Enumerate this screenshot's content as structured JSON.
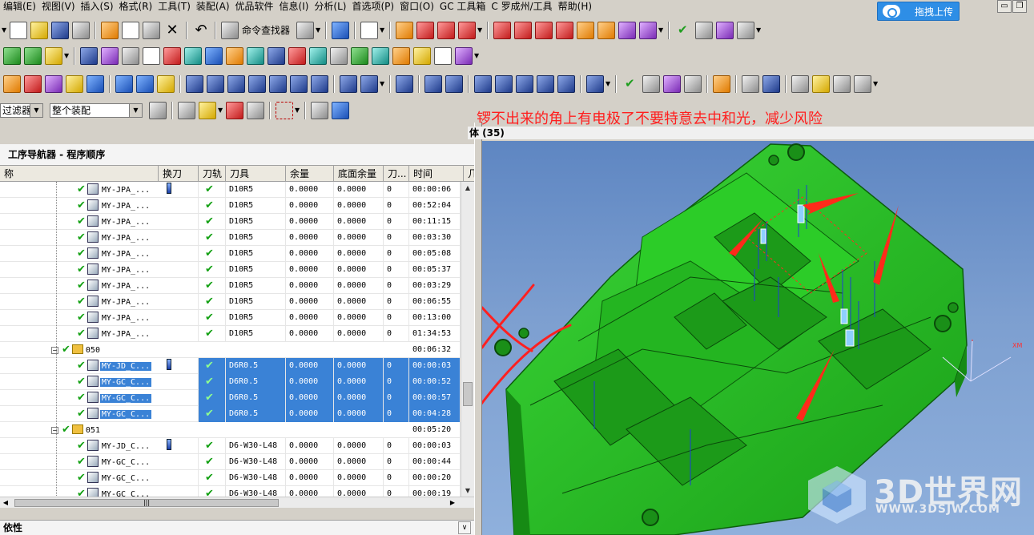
{
  "menu": [
    "编辑(E)",
    "视图(V)",
    "插入(S)",
    "格式(R)",
    "工具(T)",
    "装配(A)",
    "优品软件",
    "信息(I)",
    "分析(L)",
    "首选项(P)",
    "窗口(O)",
    "GC 工具箱",
    "C 罗成州/工具",
    "帮助(H)"
  ],
  "upload_label": "拖拽上传",
  "toolbar": {
    "command_finder": "命令查找器"
  },
  "filters": {
    "type_filter": "过滤器",
    "assembly_filter": "整个装配"
  },
  "annotation": "锣不出来的角上有电极了不要特意去中和光，减少风险",
  "navigator": {
    "title": "工序导航器 - 程序顺序",
    "columns": [
      "称",
      "换刀",
      "刀轨",
      "刀具",
      "余量",
      "底面余量",
      "刀...",
      "时间",
      "几"
    ],
    "rows": [
      {
        "type": "op",
        "name": "MY-JPA_...",
        "toolchange": true,
        "path": "✔",
        "tool": "D10R5",
        "stock": "0.0000",
        "floor": "0.0000",
        "n": "0",
        "time": "00:00:06",
        "selected": false
      },
      {
        "type": "op",
        "name": "MY-JPA_...",
        "toolchange": false,
        "path": "✔",
        "tool": "D10R5",
        "stock": "0.0000",
        "floor": "0.0000",
        "n": "0",
        "time": "00:52:04",
        "selected": false
      },
      {
        "type": "op",
        "name": "MY-JPA_...",
        "toolchange": false,
        "path": "✔",
        "tool": "D10R5",
        "stock": "0.0000",
        "floor": "0.0000",
        "n": "0",
        "time": "00:11:15",
        "selected": false
      },
      {
        "type": "op",
        "name": "MY-JPA_...",
        "toolchange": false,
        "path": "✔",
        "tool": "D10R5",
        "stock": "0.0000",
        "floor": "0.0000",
        "n": "0",
        "time": "00:03:30",
        "selected": false
      },
      {
        "type": "op",
        "name": "MY-JPA_...",
        "toolchange": false,
        "path": "✔",
        "tool": "D10R5",
        "stock": "0.0000",
        "floor": "0.0000",
        "n": "0",
        "time": "00:05:08",
        "selected": false
      },
      {
        "type": "op",
        "name": "MY-JPA_...",
        "toolchange": false,
        "path": "✔",
        "tool": "D10R5",
        "stock": "0.0000",
        "floor": "0.0000",
        "n": "0",
        "time": "00:05:37",
        "selected": false
      },
      {
        "type": "op",
        "name": "MY-JPA_...",
        "toolchange": false,
        "path": "✔",
        "tool": "D10R5",
        "stock": "0.0000",
        "floor": "0.0000",
        "n": "0",
        "time": "00:03:29",
        "selected": false
      },
      {
        "type": "op",
        "name": "MY-JPA_...",
        "toolchange": false,
        "path": "✔",
        "tool": "D10R5",
        "stock": "0.0000",
        "floor": "0.0000",
        "n": "0",
        "time": "00:06:55",
        "selected": false
      },
      {
        "type": "op",
        "name": "MY-JPA_...",
        "toolchange": false,
        "path": "✔",
        "tool": "D10R5",
        "stock": "0.0000",
        "floor": "0.0000",
        "n": "0",
        "time": "00:13:00",
        "selected": false
      },
      {
        "type": "op",
        "name": "MY-JPA_...",
        "toolchange": false,
        "path": "✔",
        "tool": "D10R5",
        "stock": "0.0000",
        "floor": "0.0000",
        "n": "0",
        "time": "01:34:53",
        "selected": false
      },
      {
        "type": "group",
        "name": "050",
        "time": "00:06:32"
      },
      {
        "type": "op",
        "name": "MY-JD_C...",
        "toolchange": true,
        "path": "✔",
        "tool": "D6R0.5",
        "stock": "0.0000",
        "floor": "0.0000",
        "n": "0",
        "time": "00:00:03",
        "selected": true
      },
      {
        "type": "op",
        "name": "MY-GC_C...",
        "toolchange": false,
        "path": "✔",
        "tool": "D6R0.5",
        "stock": "0.0000",
        "floor": "0.0000",
        "n": "0",
        "time": "00:00:52",
        "selected": true
      },
      {
        "type": "op",
        "name": "MY-GC_C...",
        "toolchange": false,
        "path": "✔",
        "tool": "D6R0.5",
        "stock": "0.0000",
        "floor": "0.0000",
        "n": "0",
        "time": "00:00:57",
        "selected": true
      },
      {
        "type": "op",
        "name": "MY-GC_C...",
        "toolchange": false,
        "path": "✔",
        "tool": "D6R0.5",
        "stock": "0.0000",
        "floor": "0.0000",
        "n": "0",
        "time": "00:04:28",
        "selected": true
      },
      {
        "type": "group",
        "name": "051",
        "time": "00:05:20"
      },
      {
        "type": "op",
        "name": "MY-JD_C...",
        "toolchange": true,
        "path": "✔",
        "tool": "D6-W30-L48",
        "stock": "0.0000",
        "floor": "0.0000",
        "n": "0",
        "time": "00:00:03",
        "selected": false
      },
      {
        "type": "op",
        "name": "MY-GC_C...",
        "toolchange": false,
        "path": "✔",
        "tool": "D6-W30-L48",
        "stock": "0.0000",
        "floor": "0.0000",
        "n": "0",
        "time": "00:00:44",
        "selected": false
      },
      {
        "type": "op",
        "name": "MY-GC_C...",
        "toolchange": false,
        "path": "✔",
        "tool": "D6-W30-L48",
        "stock": "0.0000",
        "floor": "0.0000",
        "n": "0",
        "time": "00:00:20",
        "selected": false
      },
      {
        "type": "op",
        "name": "MY-GC_C...",
        "toolchange": false,
        "path": "✔",
        "tool": "D6-W30-L48",
        "stock": "0.0000",
        "floor": "0.0000",
        "n": "0",
        "time": "00:00:19",
        "selected": false
      }
    ]
  },
  "dependencies_title": "依性",
  "viewport": {
    "title": "体 (35)",
    "axis_label": "XM"
  },
  "watermark": {
    "brand": "3D世界网",
    "url": "WWW.3DSJW.COM"
  },
  "colors": {
    "part": "#22c41e",
    "selection": "#3a82d6",
    "annotation": "#ff1e1e",
    "viewport_bg": "#6f93c9"
  }
}
